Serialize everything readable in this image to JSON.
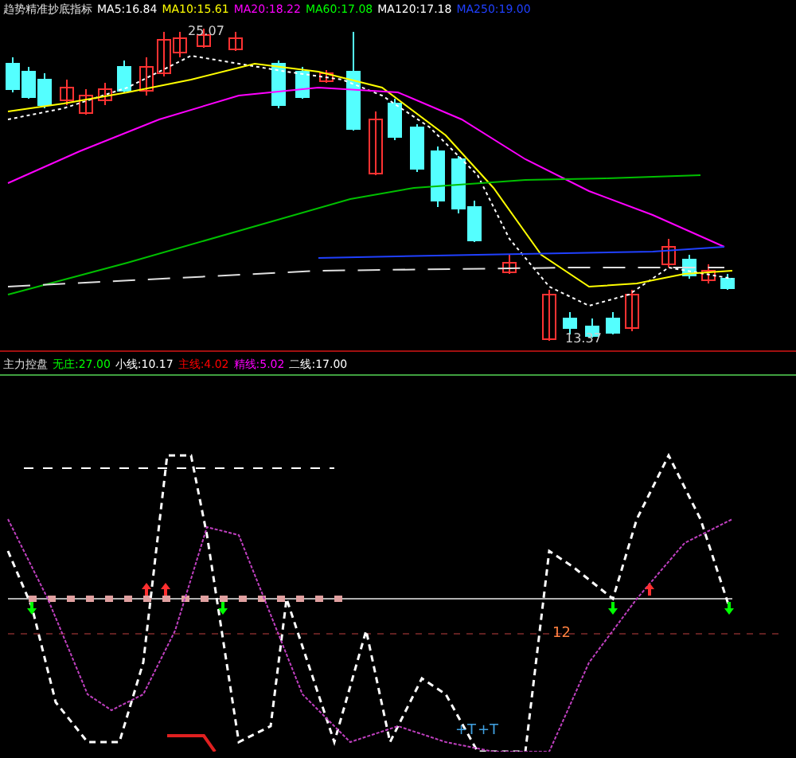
{
  "main_panel": {
    "title": "趋势精准抄底指标",
    "indicators": [
      {
        "text": "MA5:16.84",
        "color": "#ffffff"
      },
      {
        "text": "MA10:15.61",
        "color": "#ffff00"
      },
      {
        "text": "MA20:18.22",
        "color": "#ff00ff"
      },
      {
        "text": "MA60:17.08",
        "color": "#00ff00"
      },
      {
        "text": "MA120:17.18",
        "color": "#ffffff"
      },
      {
        "text": "MA250:19.00",
        "color": "#2040ff"
      }
    ],
    "high_label": "25.07",
    "low_label": "13.37"
  },
  "sub_panel": {
    "title": "主力控盘",
    "indicators": [
      {
        "text": "无庄:27.00",
        "color": "#00ff00"
      },
      {
        "text": "小线:10.17",
        "color": "#ffffff"
      },
      {
        "text": "主线:4.02",
        "color": "#ff0000"
      },
      {
        "text": "精线:5.02",
        "color": "#ff00ff"
      },
      {
        "text": "二线:17.00",
        "color": "#ffffff"
      }
    ],
    "marks": [
      {
        "text": "12",
        "color": "#ff8040"
      },
      {
        "text": "+T",
        "color": "#40a0e0"
      },
      {
        "text": "+T",
        "color": "#40a0e0"
      }
    ]
  }
}
